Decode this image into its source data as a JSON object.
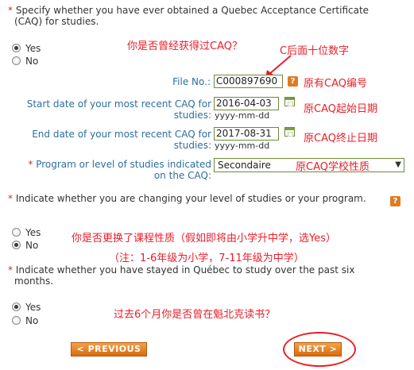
{
  "q1": {
    "marker": "*",
    "text_line1": "Specify whether you have ever obtained a Quebec Acceptance Certificate",
    "text_line2": "(CAQ) for studies.",
    "options": [
      "Yes",
      "No"
    ],
    "selected": "Yes"
  },
  "caq": {
    "file_no_label": "File No.:",
    "file_no_value": "C000897690",
    "start_label_l1": "Start date of your most recent CAQ for",
    "start_label_l2": "studies:",
    "start_value": "2016-04-03",
    "end_label_l1": "End date of your most recent CAQ for",
    "end_label_l2": "studies:",
    "end_value": "2017-08-31",
    "date_format": "yyyy-mm-dd",
    "program_marker": "*",
    "program_label_l1": "Program or level of studies indicated",
    "program_label_l2": "on the CAQ:",
    "program_value": "Secondaire",
    "help_glyph": "?"
  },
  "q2": {
    "marker": "*",
    "text": "Indicate whether you are changing your level of studies or your program.",
    "options": [
      "Yes",
      "No"
    ],
    "selected": "No"
  },
  "q3": {
    "marker": "*",
    "text_line1": "Indicate whether you have stayed in Québec to study over the past six",
    "text_line2": "months.",
    "options": [
      "Yes",
      "No"
    ],
    "selected": "Yes"
  },
  "buttons": {
    "previous": "< PREVIOUS",
    "next": "NEXT >"
  },
  "annotations": {
    "caq_question": "你是否曾经获得过CAQ？",
    "c_digits": "C后面十位数字",
    "file_no_note": "原有CAQ编号",
    "start_note": "原CAQ起始日期",
    "end_note": "原CAQ终止日期",
    "program_note": "原CAQ学校性质",
    "change_note": "你是否更换了课程性质（假如即将由小学升中学，选Yes）",
    "grade_note": "（注：1-6年级为小学，7-11年级为中学）",
    "stay_note": "过去6个月你是否曾在魁北克读书？"
  },
  "colors": {
    "annotation": "#e8202a",
    "label_blue": "#2e6e9e",
    "button_orange": "#e07b1f",
    "field_border": "#6d8a3a"
  }
}
